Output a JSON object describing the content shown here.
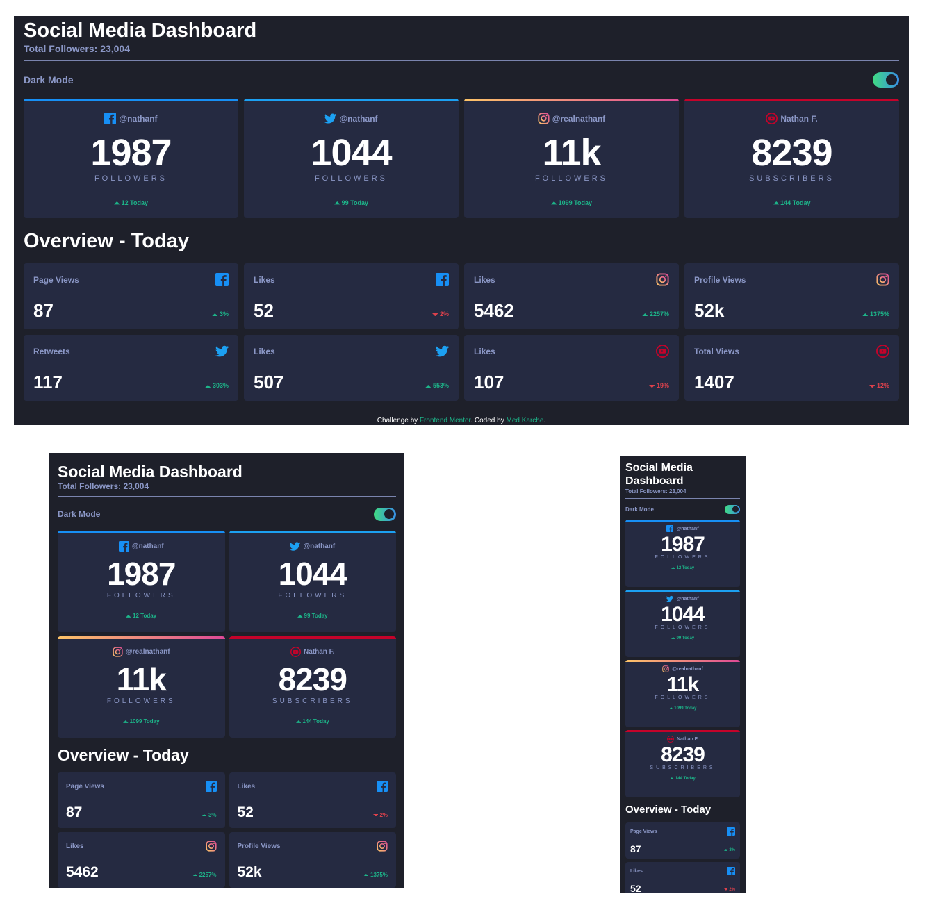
{
  "header": {
    "title": "Social Media Dashboard",
    "total_followers": "Total Followers: 23,004",
    "dark_mode_label": "Dark Mode",
    "dark_mode_on": true
  },
  "colors": {
    "background": "#1e202a",
    "card": "#252a41",
    "text_muted": "#8b97c6",
    "up": "#1db489",
    "down": "#dc414c",
    "facebook": "#178ff5",
    "twitter": "#1ca0f2",
    "instagram_start": "#fdc468",
    "instagram_end": "#df4996",
    "youtube": "#c4032a"
  },
  "followers": [
    {
      "platform": "facebook",
      "icon": "facebook-icon",
      "handle": "@nathanf",
      "count": "1987",
      "unit": "FOLLOWERS",
      "delta": "12 Today",
      "trend": "up"
    },
    {
      "platform": "twitter",
      "icon": "twitter-icon",
      "handle": "@nathanf",
      "count": "1044",
      "unit": "FOLLOWERS",
      "delta": "99 Today",
      "trend": "up"
    },
    {
      "platform": "instagram",
      "icon": "instagram-icon",
      "handle": "@realnathanf",
      "count": "11k",
      "unit": "FOLLOWERS",
      "delta": "1099 Today",
      "trend": "up"
    },
    {
      "platform": "youtube",
      "icon": "youtube-icon",
      "handle": "Nathan F.",
      "count": "8239",
      "unit": "SUBSCRIBERS",
      "delta": "144 Today",
      "trend": "up"
    }
  ],
  "overview": {
    "title": "Overview - Today",
    "items": [
      {
        "label": "Page Views",
        "platform": "facebook",
        "icon": "facebook-icon",
        "value": "87",
        "delta": "3%",
        "trend": "up"
      },
      {
        "label": "Likes",
        "platform": "facebook",
        "icon": "facebook-icon",
        "value": "52",
        "delta": "2%",
        "trend": "down"
      },
      {
        "label": "Likes",
        "platform": "instagram",
        "icon": "instagram-icon",
        "value": "5462",
        "delta": "2257%",
        "trend": "up"
      },
      {
        "label": "Profile Views",
        "platform": "instagram",
        "icon": "instagram-icon",
        "value": "52k",
        "delta": "1375%",
        "trend": "up"
      },
      {
        "label": "Retweets",
        "platform": "twitter",
        "icon": "twitter-icon",
        "value": "117",
        "delta": "303%",
        "trend": "up"
      },
      {
        "label": "Likes",
        "platform": "twitter",
        "icon": "twitter-icon",
        "value": "507",
        "delta": "553%",
        "trend": "up"
      },
      {
        "label": "Likes",
        "platform": "youtube",
        "icon": "youtube-icon",
        "value": "107",
        "delta": "19%",
        "trend": "down"
      },
      {
        "label": "Total Views",
        "platform": "youtube",
        "icon": "youtube-icon",
        "value": "1407",
        "delta": "12%",
        "trend": "down"
      }
    ]
  },
  "footer": {
    "prefix": "Challenge by ",
    "mentor_link": "Frontend Mentor",
    "middle": ". Coded by ",
    "author_link": "Med Karche",
    "suffix": "."
  }
}
